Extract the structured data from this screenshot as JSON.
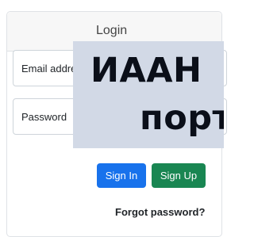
{
  "header": {
    "title": "Login"
  },
  "form": {
    "email_placeholder": "Email address",
    "password_placeholder": "Password"
  },
  "overlay": {
    "line1": "ИААН",
    "line2": "порт"
  },
  "buttons": {
    "sign_in": "Sign In",
    "sign_up": "Sign Up"
  },
  "links": {
    "forgot_password": "Forgot password?"
  },
  "colors": {
    "sign_in": "#1872ec",
    "sign_up": "#198652",
    "overlay_bg": "#d2d9e6"
  }
}
